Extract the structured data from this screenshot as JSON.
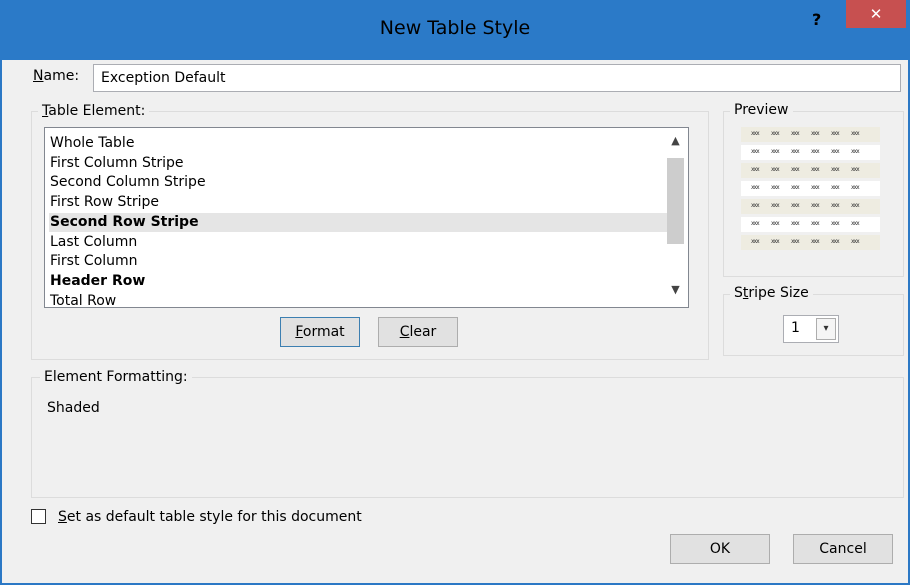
{
  "window": {
    "title": "New Table Style",
    "help_label": "?",
    "close_label": "✕"
  },
  "name_field": {
    "label_prefix": "",
    "label_mnemonic": "N",
    "label_rest": "ame:",
    "value": "Exception Default"
  },
  "table_element": {
    "title_mnemonic": "T",
    "title_rest": "able Element:",
    "items": [
      {
        "label": "Whole Table",
        "bold": false,
        "selected": false
      },
      {
        "label": "First Column Stripe",
        "bold": false,
        "selected": false
      },
      {
        "label": "Second Column Stripe",
        "bold": false,
        "selected": false
      },
      {
        "label": "First Row Stripe",
        "bold": false,
        "selected": false
      },
      {
        "label": "Second Row Stripe",
        "bold": true,
        "selected": true
      },
      {
        "label": "Last Column",
        "bold": false,
        "selected": false
      },
      {
        "label": "First Column",
        "bold": false,
        "selected": false
      },
      {
        "label": "Header Row",
        "bold": true,
        "selected": false
      },
      {
        "label": "Total Row",
        "bold": false,
        "selected": false
      }
    ],
    "scroll_up_icon": "▲",
    "scroll_down_icon": "▼",
    "format_mnemonic": "F",
    "format_rest": "ormat",
    "clear_mnemonic": "C",
    "clear_rest": "lear"
  },
  "preview": {
    "title": "Preview",
    "cell_text": "xxx",
    "rows": 7,
    "cols": 6,
    "shaded_color": "#eeece1"
  },
  "stripe_size": {
    "title_pre": "S",
    "title_mnemonic": "t",
    "title_rest": "ripe Size",
    "value": "1",
    "dropdown_icon": "▾"
  },
  "element_formatting": {
    "title": "Element Formatting:",
    "value": "Shaded"
  },
  "default_checkbox": {
    "label_mnemonic": "S",
    "label_rest": "et as default table style for this document",
    "checked": false
  },
  "buttons": {
    "ok_label": "OK",
    "cancel_label": "Cancel"
  }
}
